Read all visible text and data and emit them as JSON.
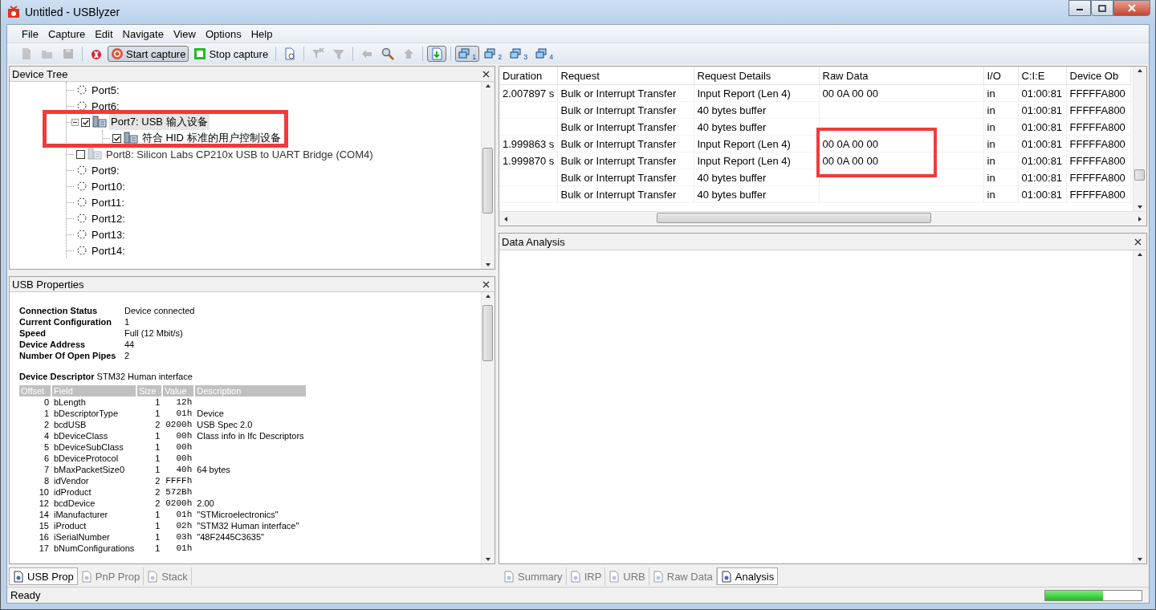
{
  "window": {
    "title": "Untitled - USBlyzer"
  },
  "menu": [
    "File",
    "Capture",
    "Edit",
    "Navigate",
    "View",
    "Options",
    "Help"
  ],
  "toolbar": [
    {
      "kind": "icon",
      "disabled": true
    },
    {
      "kind": "icon",
      "disabled": true
    },
    {
      "kind": "icon",
      "disabled": true
    },
    {
      "kind": "separator"
    },
    {
      "kind": "icon",
      "disabled": false
    },
    {
      "kind": "text",
      "label": "Start capture",
      "selected": true
    },
    {
      "kind": "text",
      "label": "Stop capture",
      "selected": false
    },
    {
      "kind": "separator"
    },
    {
      "kind": "icon",
      "disabled": false
    },
    {
      "kind": "separator"
    },
    {
      "kind": "icon",
      "disabled": true
    },
    {
      "kind": "icon",
      "disabled": true
    },
    {
      "kind": "separator"
    },
    {
      "kind": "icon",
      "disabled": true
    },
    {
      "kind": "icon",
      "disabled": false
    },
    {
      "kind": "icon",
      "disabled": true
    },
    {
      "kind": "separator"
    },
    {
      "kind": "icon",
      "disabled": false,
      "selected": true
    },
    {
      "kind": "separator"
    },
    {
      "kind": "window",
      "label": "1",
      "selected": true
    },
    {
      "kind": "window",
      "label": "2",
      "selected": false
    },
    {
      "kind": "window",
      "label": "3",
      "selected": false
    },
    {
      "kind": "window",
      "label": "4",
      "selected": false
    }
  ],
  "device_tree": {
    "title": "Device Tree",
    "items": [
      {
        "kind": "empty",
        "label": "Port5:"
      },
      {
        "kind": "empty",
        "label": "Port6:"
      },
      {
        "kind": "device",
        "label": "Port7: USB 输入设备",
        "checked": true,
        "selected": true,
        "expanded": true,
        "annotated": true,
        "children": [
          {
            "kind": "device",
            "label": "符合 HID 标准的用户控制设备",
            "checked": true,
            "selected": false
          }
        ]
      },
      {
        "kind": "device",
        "label": "Port8: Silicon Labs CP210x USB to UART Bridge (COM4)",
        "checked": false,
        "selected": false,
        "inactive": true
      },
      {
        "kind": "empty",
        "label": "Port9:"
      },
      {
        "kind": "empty",
        "label": "Port10:"
      },
      {
        "kind": "empty",
        "label": "Port11:"
      },
      {
        "kind": "empty",
        "label": "Port12:"
      },
      {
        "kind": "empty",
        "label": "Port13:"
      },
      {
        "kind": "empty",
        "label": "Port14:"
      }
    ]
  },
  "usb_properties": {
    "title": "USB Properties",
    "fields": [
      {
        "label": "Connection Status",
        "value": "Device connected"
      },
      {
        "label": "Current Configuration",
        "value": "1"
      },
      {
        "label": "Speed",
        "value": "Full (12 Mbit/s)"
      },
      {
        "label": "Device Address",
        "value": "44"
      },
      {
        "label": "Number Of Open Pipes",
        "value": "2"
      }
    ],
    "descriptor": {
      "label": "Device Descriptor",
      "value": "STM32 Human interface"
    },
    "columns": [
      "Offset",
      "Field",
      "Size",
      "Value",
      "Description"
    ],
    "rows": [
      [
        "0",
        "bLength",
        "1",
        "12h",
        ""
      ],
      [
        "1",
        "bDescriptorType",
        "1",
        "01h",
        "Device"
      ],
      [
        "2",
        "bcdUSB",
        "2",
        "0200h",
        "USB Spec 2.0"
      ],
      [
        "4",
        "bDeviceClass",
        "1",
        "00h",
        "Class info in Ifc Descriptors"
      ],
      [
        "5",
        "bDeviceSubClass",
        "1",
        "00h",
        ""
      ],
      [
        "6",
        "bDeviceProtocol",
        "1",
        "00h",
        ""
      ],
      [
        "7",
        "bMaxPacketSize0",
        "1",
        "40h",
        "64 bytes"
      ],
      [
        "8",
        "idVendor",
        "2",
        "FFFFh",
        ""
      ],
      [
        "10",
        "idProduct",
        "2",
        "572Bh",
        ""
      ],
      [
        "12",
        "bcdDevice",
        "2",
        "0200h",
        "2.00"
      ],
      [
        "14",
        "iManufacturer",
        "1",
        "01h",
        "\"STMicroelectronics\""
      ],
      [
        "15",
        "iProduct",
        "1",
        "02h",
        "\"STM32 Human interface\""
      ],
      [
        "16",
        "iSerialNumber",
        "1",
        "03h",
        "\"48F2445C3635\""
      ],
      [
        "17",
        "bNumConfigurations",
        "1",
        "01h",
        ""
      ]
    ]
  },
  "left_tabs": [
    {
      "label": "USB Prop",
      "selected": true
    },
    {
      "label": "PnP Prop",
      "selected": false
    },
    {
      "label": "Stack",
      "selected": false
    }
  ],
  "requests": {
    "columns": [
      "Duration",
      "Request",
      "Request Details",
      "Raw Data",
      "I/O",
      "C:I:E",
      "Device Ob"
    ],
    "rows": [
      {
        "cells": [
          "2.007897 s",
          "Bulk or Interrupt Transfer",
          "Input Report (Len 4)",
          "00 0A 00 00",
          "in",
          "01:00:81",
          "FFFFFA800"
        ],
        "annotated": false
      },
      {
        "cells": [
          "",
          "Bulk or Interrupt Transfer",
          "40 bytes buffer",
          "",
          "in",
          "01:00:81",
          "FFFFFA800"
        ],
        "annotated": false
      },
      {
        "cells": [
          "",
          "Bulk or Interrupt Transfer",
          "40 bytes buffer",
          "",
          "in",
          "01:00:81",
          "FFFFFA800"
        ],
        "annotated": false
      },
      {
        "cells": [
          "1.999863 s",
          "Bulk or Interrupt Transfer",
          "Input Report (Len 4)",
          "00 0A 00 00",
          "in",
          "01:00:81",
          "FFFFFA800"
        ],
        "annotated": true
      },
      {
        "cells": [
          "1.999870 s",
          "Bulk or Interrupt Transfer",
          "Input Report (Len 4)",
          "00 0A 00 00",
          "in",
          "01:00:81",
          "FFFFFA800"
        ],
        "annotated": true
      },
      {
        "cells": [
          "",
          "Bulk or Interrupt Transfer",
          "40 bytes buffer",
          "",
          "in",
          "01:00:81",
          "FFFFFA800"
        ],
        "annotated": false
      },
      {
        "cells": [
          "",
          "Bulk or Interrupt Transfer",
          "40 bytes buffer",
          "",
          "in",
          "01:00:81",
          "FFFFFA800"
        ],
        "annotated": false
      }
    ]
  },
  "data_analysis": {
    "title": "Data Analysis"
  },
  "right_tabs": [
    {
      "label": "Summary",
      "selected": false
    },
    {
      "label": "IRP",
      "selected": false
    },
    {
      "label": "URB",
      "selected": false
    },
    {
      "label": "Raw Data",
      "selected": false
    },
    {
      "label": "Analysis",
      "selected": true
    }
  ],
  "status_bar": {
    "text": "Ready",
    "level": 0.6
  }
}
